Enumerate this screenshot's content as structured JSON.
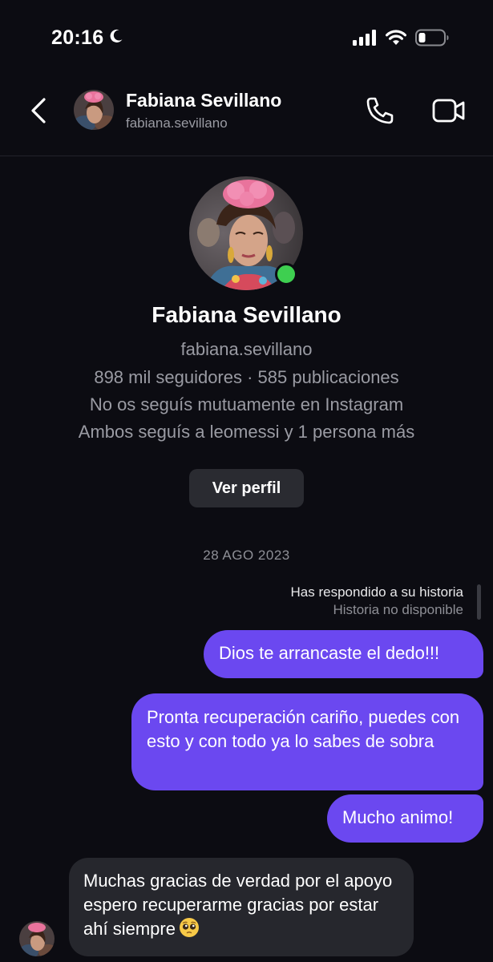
{
  "status_bar": {
    "time": "20:16",
    "icons": [
      "moon-icon",
      "cellular-signal-icon",
      "wifi-icon",
      "battery-icon"
    ]
  },
  "header": {
    "name": "Fabiana Sevillano",
    "username": "fabiana.sevillano",
    "icons": [
      "back-chevron-icon",
      "phone-icon",
      "video-camera-icon"
    ]
  },
  "profile": {
    "name": "Fabiana Sevillano",
    "username": "fabiana.sevillano",
    "stats": "898 mil seguidores · 585 publicaciones",
    "mutual_status": "No os seguís mutuamente en Instagram",
    "mutual_following": "Ambos seguís a leomessi y 1 persona más",
    "view_profile_label": "Ver perfil",
    "online": true
  },
  "conversation": {
    "date": "28 AGO 2023",
    "story_reply": {
      "label": "Has respondido a su historia",
      "sublabel": "Historia no disponible"
    },
    "messages": [
      {
        "from": "me",
        "text": "Dios te arrancaste el dedo!!!"
      },
      {
        "from": "me",
        "text": "Pronta recuperación cariño, puedes con esto y con todo ya lo sabes de sobra"
      },
      {
        "from": "me",
        "text": "Mucho animo!"
      },
      {
        "from": "them",
        "text": "Muchas gracias de verdad por el apoyo espero recuperarme gracias por estar ahí siempre",
        "emoji": "pleading-face-icon"
      }
    ]
  },
  "colors": {
    "background": "#0c0c12",
    "sent_bubble": "#6b48f0",
    "received_bubble": "#26272d",
    "online": "#3ecf50",
    "secondary_text": "#9a9ba3"
  }
}
